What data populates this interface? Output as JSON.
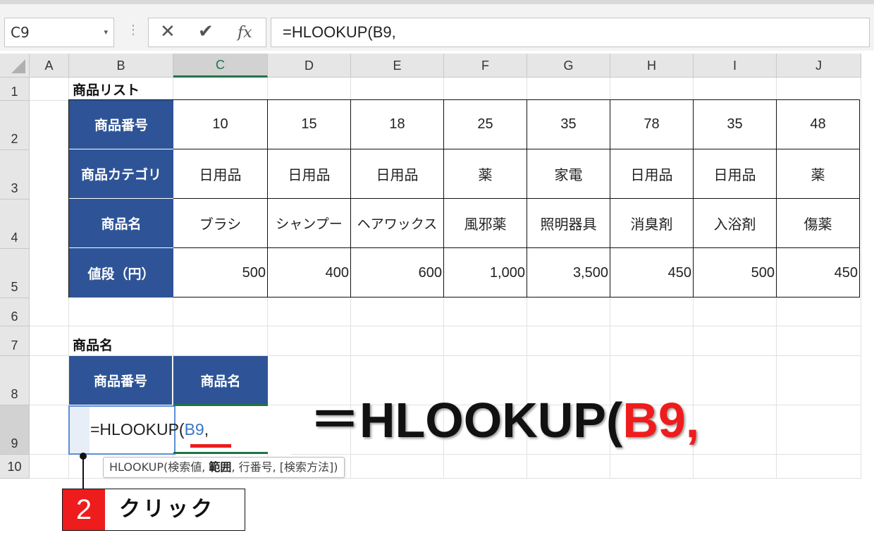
{
  "toolbar": {
    "name_box": "C9",
    "cancel_icon": "✕",
    "enter_icon": "✔",
    "fx_label": "fx",
    "formula": "=HLOOKUP(B9,"
  },
  "columns": [
    "A",
    "B",
    "C",
    "D",
    "E",
    "F",
    "G",
    "H",
    "I",
    "J"
  ],
  "rows": [
    "1",
    "2",
    "3",
    "4",
    "5",
    "6",
    "7",
    "8",
    "9",
    "10"
  ],
  "labels": {
    "product_list": "商品リスト",
    "product_name_section": "商品名"
  },
  "table": {
    "headers": [
      "商品番号",
      "商品カテゴリ",
      "商品名",
      "値段（円）"
    ],
    "ids": [
      "10",
      "15",
      "18",
      "25",
      "35",
      "78",
      "35",
      "48"
    ],
    "categories": [
      "日用品",
      "日用品",
      "日用品",
      "薬",
      "家電",
      "日用品",
      "日用品",
      "薬"
    ],
    "names": [
      "ブラシ",
      "シャンプー",
      "ヘアワックス",
      "風邪薬",
      "照明器具",
      "消臭剤",
      "入浴剤",
      "傷薬"
    ],
    "prices": [
      "500",
      "400",
      "600",
      "1,000",
      "3,500",
      "450",
      "500",
      "450"
    ]
  },
  "lookup": {
    "header_id": "商品番号",
    "header_name": "商品名",
    "edit_prefix": "=HLOOKUP(",
    "edit_ref": "B9",
    "edit_suffix": ","
  },
  "tooltip": {
    "func": "HLOOKUP(",
    "arg1": "検索値, ",
    "arg2": "範囲",
    "rest": ", 行番号, [検索方法])"
  },
  "callout": {
    "big_prefix": "＝HLOOKUP(",
    "big_red": "B9,"
  },
  "step": {
    "number": "2",
    "label": "クリック"
  },
  "colors": {
    "header_blue": "#2e5497",
    "accent_red": "#ee1c1c",
    "ref_blue": "#3b74c8",
    "excel_green": "#217346"
  }
}
